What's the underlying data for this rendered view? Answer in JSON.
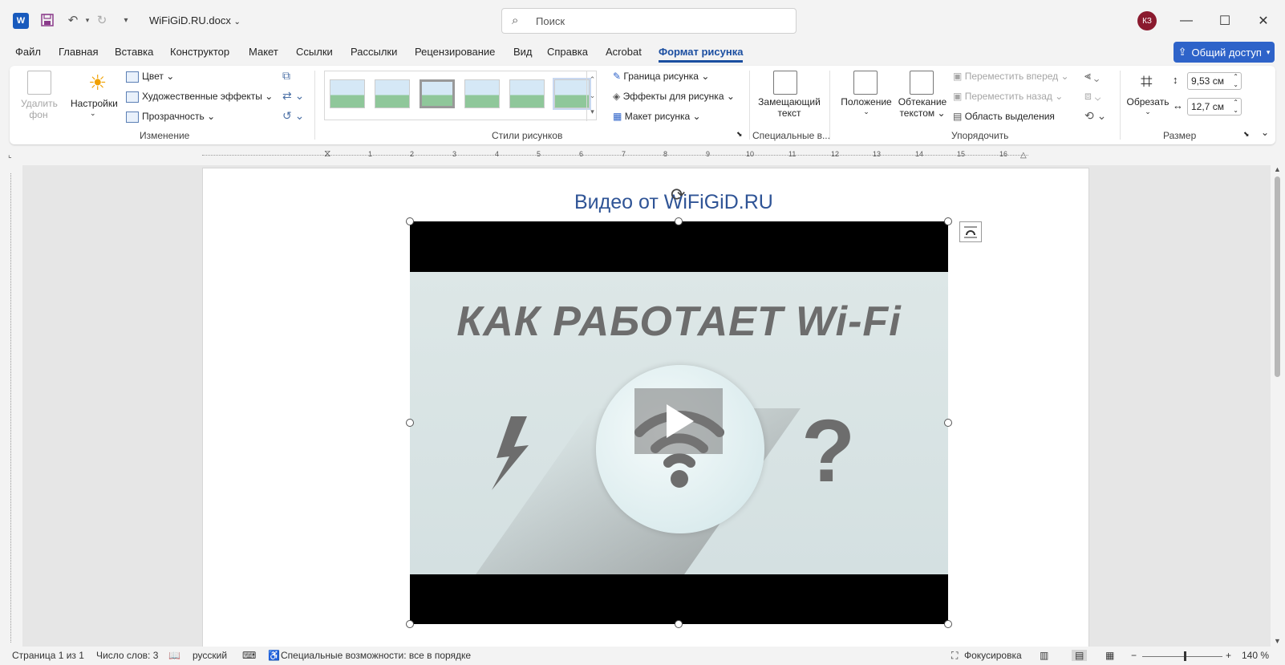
{
  "app": {
    "doc_title": "WiFiGiD.RU.docx",
    "search_placeholder": "Поиск",
    "avatar_initials": "КЗ",
    "word_letter": "W"
  },
  "tabs": [
    "Файл",
    "Главная",
    "Вставка",
    "Конструктор",
    "Макет",
    "Ссылки",
    "Рассылки",
    "Рецензирование",
    "Вид",
    "Справка",
    "Acrobat",
    "Формат рисунка"
  ],
  "active_tab": "Формат рисунка",
  "share_label": "Общий доступ",
  "ribbon": {
    "remove_bg": [
      "Удалить",
      "фон"
    ],
    "corrections": "Настройки",
    "color": "Цвет",
    "artistic": "Художественные эффекты",
    "transparency": "Прозрачность",
    "group_adjust": "Изменение",
    "border": "Граница рисунка",
    "effects": "Эффекты для рисунка",
    "layout": "Макет рисунка",
    "group_styles": "Стили рисунков",
    "alt_text": [
      "Замещающий",
      "текст"
    ],
    "group_special": "Специальные в...",
    "position": "Положение",
    "wrap": [
      "Обтекание",
      "текстом"
    ],
    "bring_forward": "Переместить вперед",
    "send_backward": "Переместить назад",
    "selection_pane": "Область выделения",
    "group_arrange": "Упорядочить",
    "crop": "Обрезать",
    "height": "9,53 см",
    "width": "12,7 см",
    "group_size": "Размер"
  },
  "ruler_numbers": [
    "1",
    "2",
    "3",
    "4",
    "5",
    "6",
    "7",
    "8",
    "9",
    "10",
    "11",
    "12",
    "13",
    "14",
    "15",
    "16"
  ],
  "document": {
    "heading": "Видео от WiFiGiD.RU",
    "video_title": "КАК РАБОТАЕТ Wi-Fi",
    "question_mark": "?"
  },
  "status": {
    "page": "Страница 1 из 1",
    "words": "Число слов: 3",
    "language": "русский",
    "accessibility": "Специальные возможности: все в порядке",
    "focus": "Фокусировка",
    "zoom": "140 %"
  },
  "colors": {
    "accent": "#1b4ea0",
    "share": "#2e63c9",
    "heading": "#2f5496",
    "avatar": "#8a1a2e"
  }
}
